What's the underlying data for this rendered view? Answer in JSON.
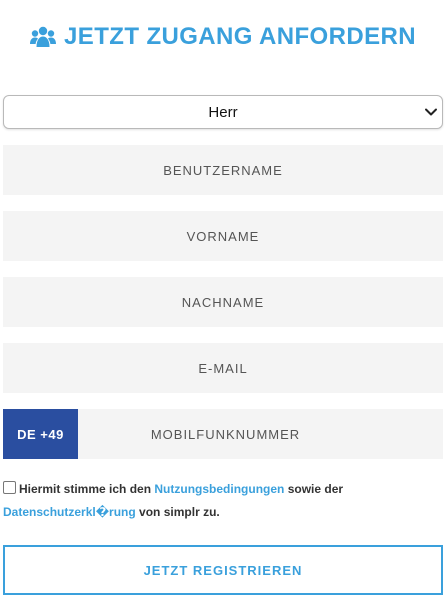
{
  "header": {
    "icon": "users-icon",
    "title": "JETZT ZUGANG ANFORDERN"
  },
  "form": {
    "salutation": {
      "selected": "Herr"
    },
    "username": {
      "placeholder": "BENUTZERNAME"
    },
    "first_name": {
      "placeholder": "VORNAME"
    },
    "last_name": {
      "placeholder": "NACHNAME"
    },
    "email": {
      "placeholder": "E-MAIL"
    },
    "phone": {
      "country_code": "DE +49",
      "placeholder": "MOBILFUNKNUMMER"
    },
    "consent": {
      "checked": false,
      "text_1": "Hiermit stimme ich den ",
      "link_terms": "Nutzungsbedingungen",
      "text_2": " sowie der",
      "link_privacy": "Datenschutzerkl�rung",
      "text_3": " von simplr zu."
    },
    "submit_label": "JETZT REGISTRIEREN"
  },
  "colors": {
    "accent": "#3aa0dc",
    "country_code_bg": "#2a4ea0",
    "field_bg": "#f4f4f4"
  }
}
